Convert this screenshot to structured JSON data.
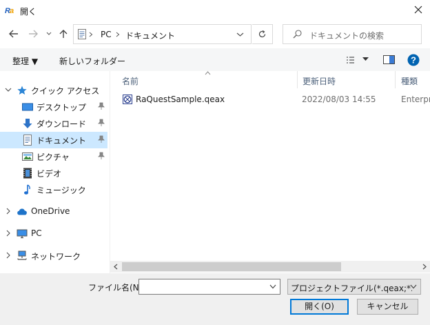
{
  "window": {
    "title": "開く"
  },
  "address": {
    "breadcrumb": [
      "PC",
      "ドキュメント"
    ]
  },
  "search": {
    "placeholder": "ドキュメントの検索"
  },
  "toolbar": {
    "organize_label": "整理 ▼",
    "new_folder_label": "新しいフォルダー"
  },
  "nav": {
    "items": [
      {
        "label": "クイック アクセス",
        "icon": "star-icon"
      },
      {
        "label": "デスクトップ",
        "icon": "desktop-icon"
      },
      {
        "label": "ダウンロード",
        "icon": "download-icon"
      },
      {
        "label": "ドキュメント",
        "icon": "document-icon",
        "selected": true
      },
      {
        "label": "ピクチャ",
        "icon": "picture-icon"
      },
      {
        "label": "ビデオ",
        "icon": "video-icon"
      },
      {
        "label": "ミュージック",
        "icon": "music-icon"
      },
      {
        "label": "OneDrive",
        "icon": "cloud-icon"
      },
      {
        "label": "PC",
        "icon": "pc-icon"
      },
      {
        "label": "ネットワーク",
        "icon": "network-icon"
      }
    ]
  },
  "columns": {
    "name": "名前",
    "date": "更新日時",
    "type": "種類"
  },
  "files": [
    {
      "name": "RaQuestSample.qeax",
      "date": "2022/08/03 14:55",
      "type": "Enterpri"
    }
  ],
  "bottom": {
    "filename_label": "ファイル名(N):",
    "filename_value": "",
    "filetype_value": "プロジェクトファイル(*.qeax;*.qea;*.",
    "open_label": "開く(O)",
    "cancel_label": "キャンセル"
  },
  "colors": {
    "accent": "#0078d7",
    "selection": "#cce8ff",
    "help": "#0063b1"
  }
}
